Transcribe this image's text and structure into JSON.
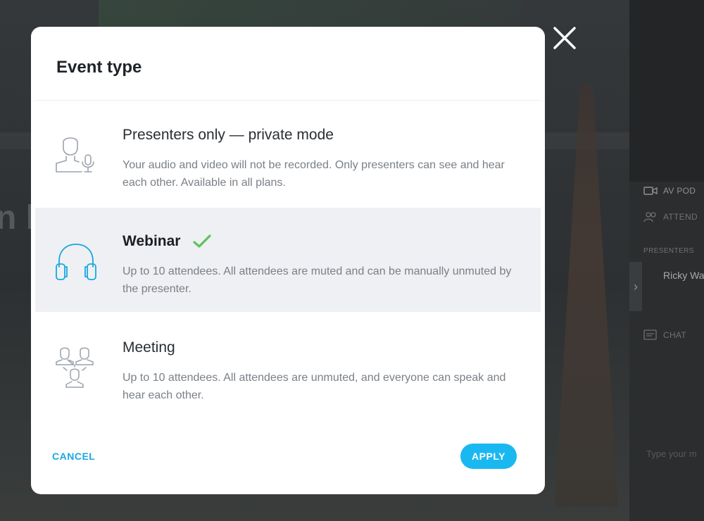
{
  "modal": {
    "title": "Event type",
    "options": [
      {
        "title": "Presenters only — private mode",
        "description": "Your audio and video will not be recorded. Only presenters can see and hear each other. Available in all plans.",
        "icon": "presenter-mic-icon",
        "selected": false
      },
      {
        "title": "Webinar",
        "description": "Up to 10 attendees. All attendees are muted and can be manually unmuted by the presenter.",
        "icon": "headphones-icon",
        "selected": true
      },
      {
        "title": "Meeting",
        "description": "Up to 10 attendees. All attendees are unmuted, and everyone can speak and hear each other.",
        "icon": "group-icon",
        "selected": false
      }
    ],
    "cancel_label": "CANCEL",
    "apply_label": "APPLY"
  },
  "background": {
    "stage_text": "n li",
    "side_panel": {
      "av_pod_label": "AV POD",
      "attendees_label": "ATTEND",
      "presenters_label": "PRESENTERS",
      "presenter_name": "Ricky Wa",
      "chat_label": "CHAT",
      "chat_placeholder": "Type your m"
    }
  },
  "colors": {
    "accent": "#1ab8f0",
    "check": "#5cc35c",
    "selected_bg": "#eef0f3",
    "icon_gray": "#9aa3ad",
    "icon_blue": "#19a8e0"
  }
}
